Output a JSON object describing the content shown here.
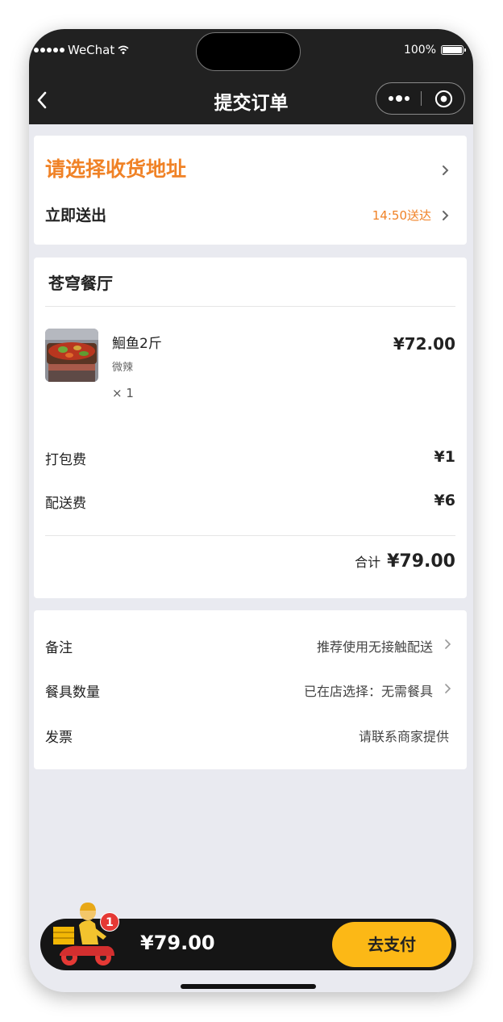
{
  "status_bar": {
    "carrier": "WeChat",
    "battery": "100%"
  },
  "nav": {
    "title": "提交订单"
  },
  "address": {
    "prompt": "请选择收货地址",
    "delivery_mode": "立即送出",
    "delivery_time": "14:50送达"
  },
  "order": {
    "restaurant": "苍穹餐厅",
    "item": {
      "name": "鮰鱼2斤",
      "spec": "微辣",
      "qty": "× 1",
      "price": "¥72.00"
    },
    "fees": [
      {
        "label": "打包费",
        "value": "¥1"
      },
      {
        "label": "配送费",
        "value": "¥6"
      }
    ],
    "total_label": "合计",
    "total_value": "¥79.00"
  },
  "options": [
    {
      "label": "备注",
      "value": "推荐使用无接触配送"
    },
    {
      "label": "餐具数量",
      "value": "已在店选择：无需餐具"
    },
    {
      "label": "发票",
      "value": "请联系商家提供"
    }
  ],
  "pay_bar": {
    "badge": "1",
    "total": "¥79.00",
    "button": "去支付"
  },
  "colors": {
    "accent": "#f08226",
    "pay_button": "#fcb816",
    "badge": "#e53935",
    "topbar": "#212121"
  }
}
